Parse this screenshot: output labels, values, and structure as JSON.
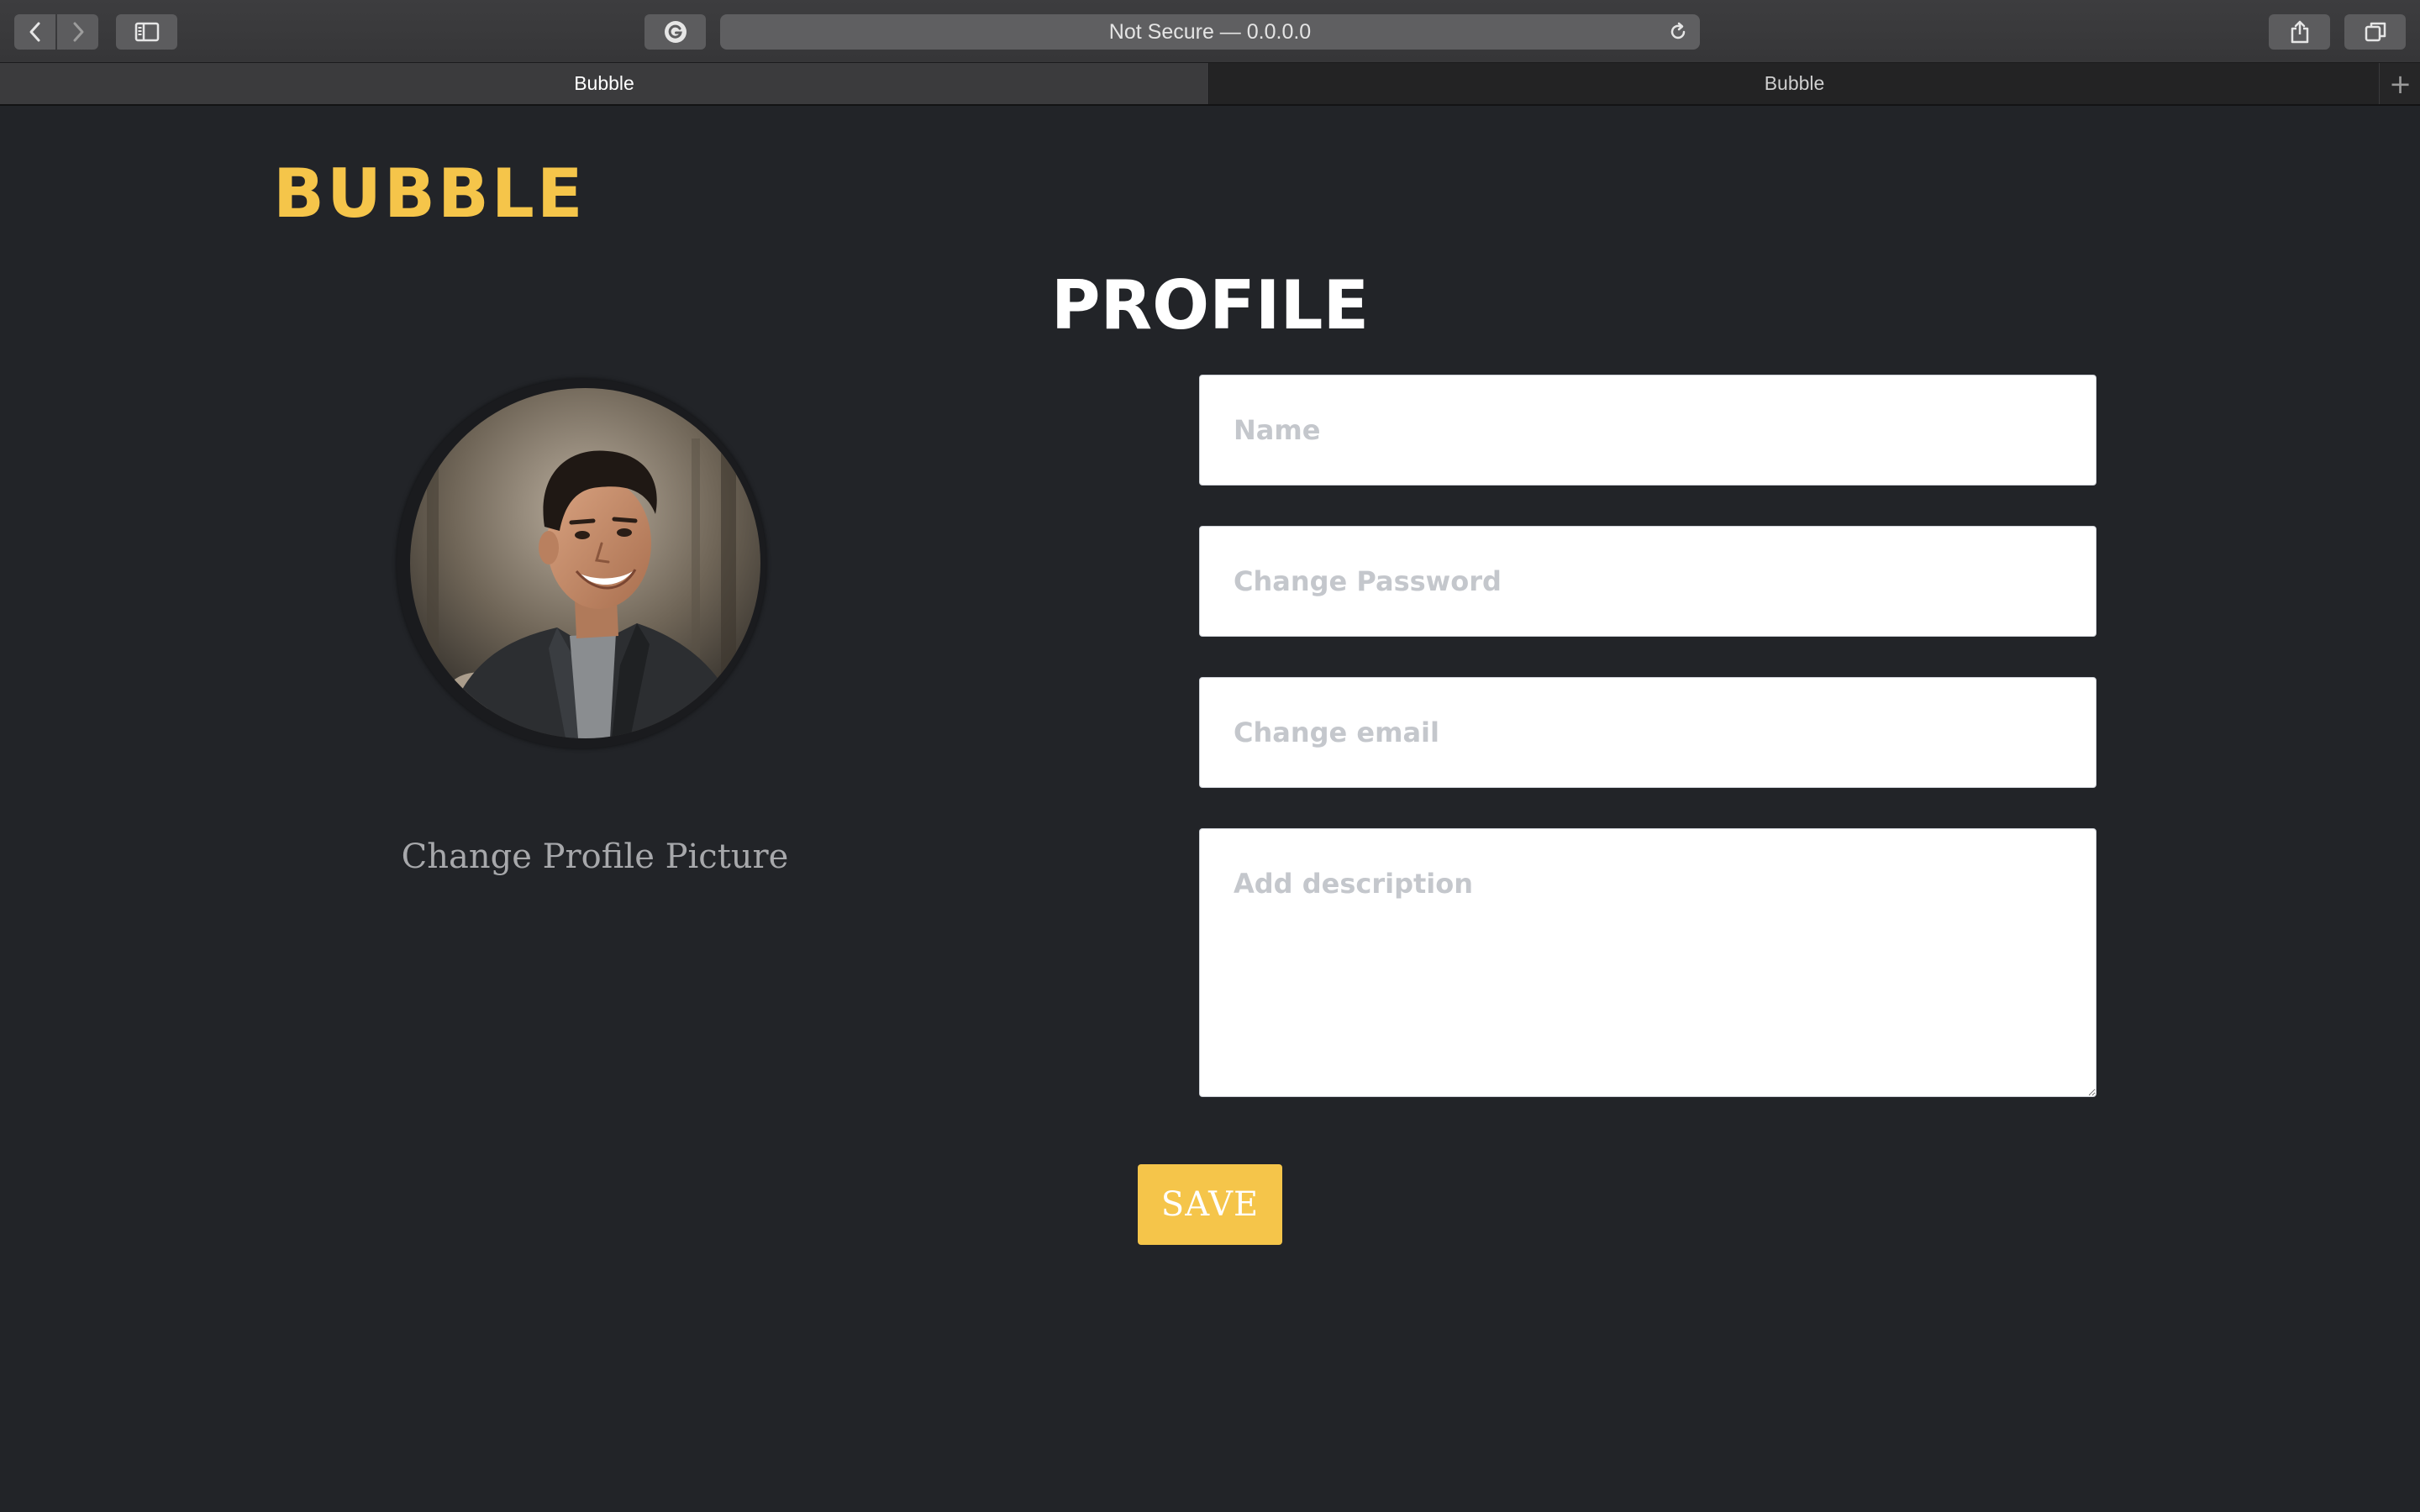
{
  "browser": {
    "url_text": "Not Secure — 0.0.0.0",
    "tabs": [
      {
        "label": "Bubble",
        "active": true
      },
      {
        "label": "Bubble",
        "active": false
      }
    ],
    "new_tab_label": "+"
  },
  "header": {
    "logo_text": "BUBBLE"
  },
  "main": {
    "title": "PROFILE",
    "change_picture_label": "Change Profile Picture",
    "form": {
      "name_placeholder": "Name",
      "name_value": "",
      "password_placeholder": "Change Password",
      "password_value": "",
      "email_placeholder": "Change email",
      "email_value": "",
      "description_placeholder": "Add description",
      "description_value": ""
    },
    "save_label": "SAVE"
  },
  "colors": {
    "accent": "#f5c54a",
    "background": "#222428",
    "field_bg": "#ffffff",
    "placeholder": "#c4c7cc"
  }
}
